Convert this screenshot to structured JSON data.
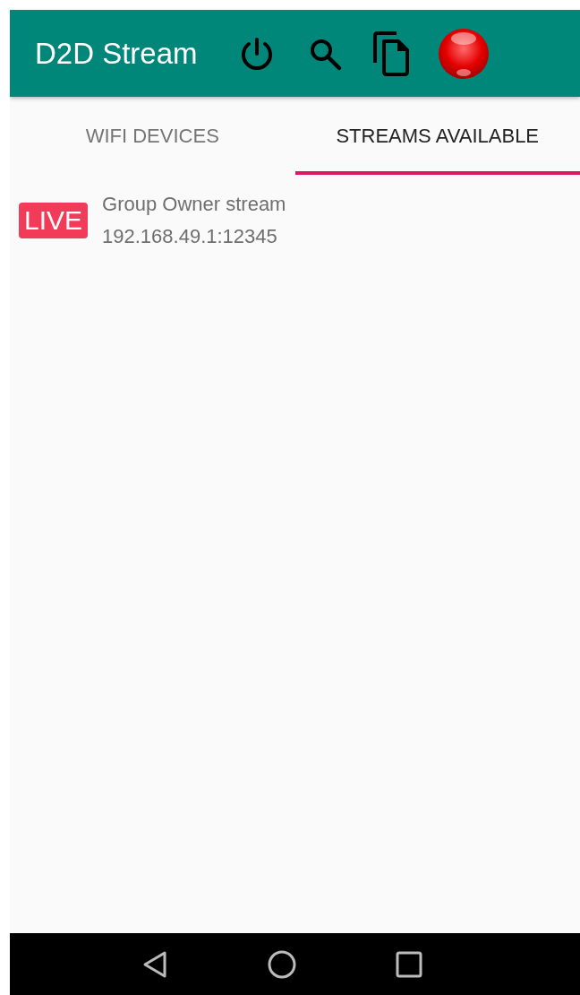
{
  "app_bar": {
    "title": "D2D Stream"
  },
  "tabs": [
    {
      "label": "WIFI DEVICES",
      "selected": false
    },
    {
      "label": "STREAMS AVAILABLE",
      "selected": true
    }
  ],
  "streams": [
    {
      "badge": "LIVE",
      "name": "Group Owner stream",
      "address": "192.168.49.1:12345"
    }
  ]
}
